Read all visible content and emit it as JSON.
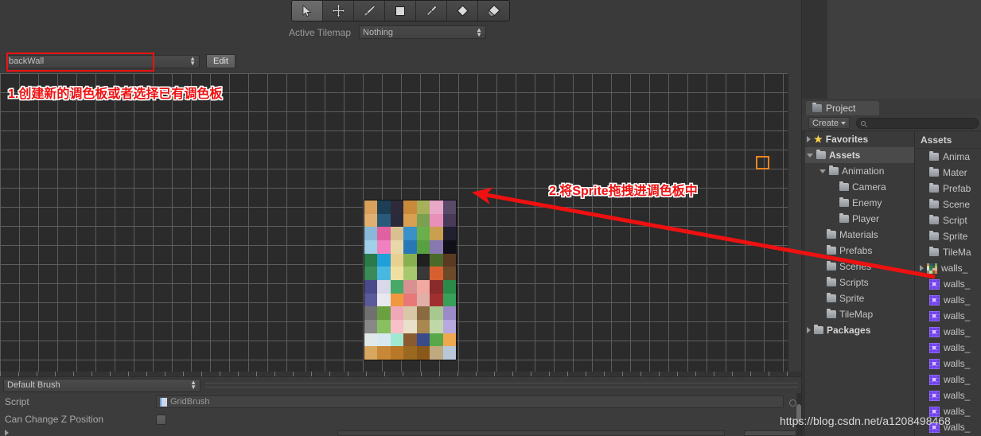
{
  "palette_window": {
    "toolbar": {
      "tools": [
        {
          "name": "select-tool",
          "icon": "cursor-arrow-icon",
          "active": true
        },
        {
          "name": "move-tool",
          "icon": "move-arrows-icon",
          "active": false
        },
        {
          "name": "paint-tool",
          "icon": "paintbrush-icon",
          "active": false
        },
        {
          "name": "box-fill-tool",
          "icon": "square-icon",
          "active": false
        },
        {
          "name": "picker-tool",
          "icon": "eyedropper-icon",
          "active": false
        },
        {
          "name": "erase-tool",
          "icon": "eraser-icon",
          "active": false
        },
        {
          "name": "fill-tool",
          "icon": "paint-bucket-icon",
          "active": false
        }
      ],
      "active_tilemap_label": "Active Tilemap",
      "active_tilemap_value": "Nothing"
    },
    "palette_bar": {
      "palette_value": "backWall",
      "edit_label": "Edit"
    },
    "brush_bar": {
      "brush_value": "Default Brush"
    },
    "inspector": {
      "rows": [
        {
          "label": "Script",
          "value": "GridBrush"
        },
        {
          "label": "Can Change Z Position",
          "value": ""
        }
      ]
    }
  },
  "project_window": {
    "tab_label": "Project",
    "create_label": "Create",
    "search_placeholder": "",
    "tree": [
      {
        "label": "Favorites",
        "depth": 0,
        "arrow": "closed",
        "icon": "star-icon",
        "bold": true,
        "selected": false
      },
      {
        "label": "Assets",
        "depth": 0,
        "arrow": "open",
        "icon": "folder-icon",
        "bold": true,
        "selected": true
      },
      {
        "label": "Animation",
        "depth": 1,
        "arrow": "open",
        "icon": "folder-icon",
        "bold": false,
        "selected": false
      },
      {
        "label": "Camera",
        "depth": 2,
        "arrow": "none",
        "icon": "folder-icon",
        "bold": false,
        "selected": false
      },
      {
        "label": "Enemy",
        "depth": 2,
        "arrow": "none",
        "icon": "folder-icon",
        "bold": false,
        "selected": false
      },
      {
        "label": "Player",
        "depth": 2,
        "arrow": "none",
        "icon": "folder-icon",
        "bold": false,
        "selected": false
      },
      {
        "label": "Materials",
        "depth": 1,
        "arrow": "none",
        "icon": "folder-icon",
        "bold": false,
        "selected": false
      },
      {
        "label": "Prefabs",
        "depth": 1,
        "arrow": "none",
        "icon": "folder-icon",
        "bold": false,
        "selected": false
      },
      {
        "label": "Scenes",
        "depth": 1,
        "arrow": "none",
        "icon": "folder-icon",
        "bold": false,
        "selected": false
      },
      {
        "label": "Scripts",
        "depth": 1,
        "arrow": "none",
        "icon": "folder-icon",
        "bold": false,
        "selected": false
      },
      {
        "label": "Sprite",
        "depth": 1,
        "arrow": "none",
        "icon": "folder-icon",
        "bold": false,
        "selected": false
      },
      {
        "label": "TileMap",
        "depth": 1,
        "arrow": "none",
        "icon": "folder-icon",
        "bold": false,
        "selected": false
      },
      {
        "label": "Packages",
        "depth": 0,
        "arrow": "closed",
        "icon": "folder-icon",
        "bold": true,
        "selected": false
      }
    ],
    "list_header": "Assets",
    "list_items": [
      {
        "label": "Anima",
        "icon": "folder-icon"
      },
      {
        "label": "Mater",
        "icon": "folder-icon"
      },
      {
        "label": "Prefab",
        "icon": "folder-icon"
      },
      {
        "label": "Scene",
        "icon": "folder-icon"
      },
      {
        "label": "Script",
        "icon": "folder-icon"
      },
      {
        "label": "Sprite",
        "icon": "folder-icon"
      },
      {
        "label": "TileMa",
        "icon": "folder-icon"
      },
      {
        "label": "walls_",
        "icon": "tileset-icon"
      },
      {
        "label": "walls_",
        "icon": "sprite-icon"
      },
      {
        "label": "walls_",
        "icon": "sprite-icon"
      },
      {
        "label": "walls_",
        "icon": "sprite-icon"
      },
      {
        "label": "walls_",
        "icon": "sprite-icon"
      },
      {
        "label": "walls_",
        "icon": "sprite-icon"
      },
      {
        "label": "walls_",
        "icon": "sprite-icon"
      },
      {
        "label": "walls_",
        "icon": "sprite-icon"
      },
      {
        "label": "walls_",
        "icon": "sprite-icon"
      },
      {
        "label": "walls_",
        "icon": "sprite-icon"
      },
      {
        "label": "walls_",
        "icon": "sprite-icon"
      }
    ]
  },
  "annotations": {
    "step1": "1.创建新的调色板或者选择已有调色板",
    "step2": "2.将Sprite拖拽进调色板中",
    "highlight_color": "#ee1111",
    "arrow_color": "#ee1111"
  },
  "watermark": "https://blog.csdn.net/a1208498468",
  "colors": {
    "background": "#383838",
    "panel": "#3a3a3a",
    "grid": "#2b2b2b",
    "grid_line": "#5d5d5d",
    "selection": "#f08522",
    "sprite_purple": "#6f3ef0"
  },
  "tile_sheet": {
    "columns": 7,
    "rows": 12,
    "colors": [
      "#d9a05b",
      "#1c3f55",
      "#2e2a3a",
      "#c98a3a",
      "#a8b05a",
      "#e8a8c8",
      "#5a4a6a",
      "#e0b070",
      "#2a5a7a",
      "#2a2a3a",
      "#d8a050",
      "#7aa050",
      "#e890b8",
      "#4a3a5a",
      "#8ab8d8",
      "#e060a0",
      "#d8c090",
      "#3a90c8",
      "#6ab04a",
      "#c8a050",
      "#202030",
      "#a0d0e8",
      "#f080c0",
      "#e8d8a8",
      "#2878b8",
      "#58a040",
      "#8878b0",
      "#101018",
      "#2a7a4a",
      "#20a0d8",
      "#e8d090",
      "#88b050",
      "#202020",
      "#4a6a2a",
      "#5a3a20",
      "#3a8a5a",
      "#48b8e0",
      "#f0e0a0",
      "#a8c870",
      "#383838",
      "#d86030",
      "#6a4a28",
      "#4a4a8a",
      "#d8d8e8",
      "#48a868",
      "#d89090",
      "#f0a8a0",
      "#8a2a2a",
      "#2a8a48",
      "#5a5a9a",
      "#e8e8f0",
      "#f09840",
      "#e87878",
      "#e0b0a8",
      "#a03030",
      "#38a058",
      "#707070",
      "#6aa040",
      "#f0a8b8",
      "#d8c8a8",
      "#8a6a40",
      "#a8c890",
      "#9a8ac8",
      "#888888",
      "#88c060",
      "#f8c0c8",
      "#e8e0c8",
      "#a88850",
      "#c0d8a8",
      "#b8a8e0",
      "#e0e8e8",
      "#d8e8f0",
      "#a0e8d0",
      "#8a5a30",
      "#3a4a8a",
      "#58a848",
      "#f0a850",
      "#d8a860",
      "#c88838",
      "#b87828",
      "#9a6820",
      "#8a5818",
      "#c0a880",
      "#b8c8d8",
      "#68b8e0",
      "#d8a868",
      "#58484a",
      "#e0b878",
      "#d8d0e8",
      "#a8b8d0",
      "#9ab0c8",
      "#a86838",
      "#e8d8c0",
      "#f0e8d8",
      "#b87830",
      "#c8d8e8",
      "#d8c8a0",
      "#c8b890",
      "#f0d8a0",
      "#2850d8",
      "#4a4a4a",
      "#58a048",
      "#e0e8f0",
      "#d8d8e0",
      "#e8d8b8",
      "#7a1a1a",
      "#e08820",
      "#1a1a1a",
      "#e8d0a0",
      "#1830c8",
      "#f0f0f8",
      "#282828"
    ]
  }
}
